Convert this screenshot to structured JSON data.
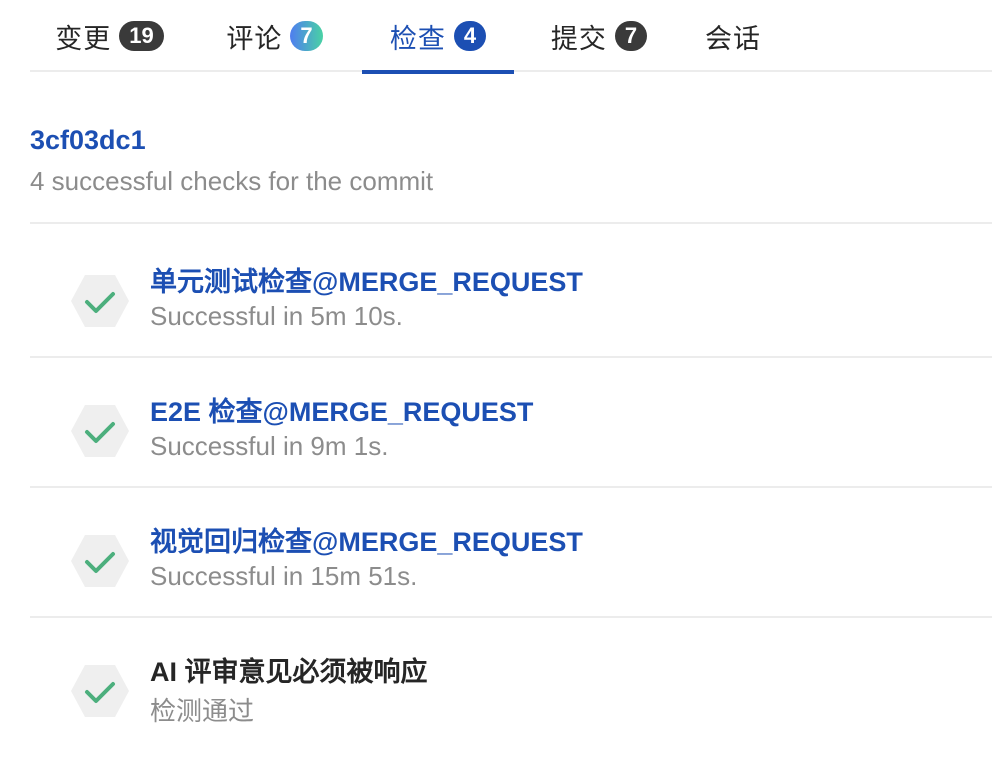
{
  "tabs": [
    {
      "label": "变更",
      "count": "19"
    },
    {
      "label": "评论",
      "count": "7"
    },
    {
      "label": "检查",
      "count": "4"
    },
    {
      "label": "提交",
      "count": "7"
    },
    {
      "label": "会话"
    }
  ],
  "active_tab": "检查",
  "colors": {
    "accent": "#1c4fb3",
    "success": "#4caf7d",
    "muted_text": "#8c8c8c",
    "badge_dark": "#3a3a3a"
  },
  "commit": {
    "hash": "3cf03dc1",
    "summary": "4 successful checks for the commit"
  },
  "checks": [
    {
      "title": "单元测试检查@MERGE_REQUEST",
      "status": "Successful in 5m 10s.",
      "icon": "check-icon",
      "link": true
    },
    {
      "title": "E2E 检查@MERGE_REQUEST",
      "status": "Successful in 9m 1s.",
      "icon": "check-icon",
      "link": true
    },
    {
      "title": "视觉回归检查@MERGE_REQUEST",
      "status": "Successful in 15m 51s.",
      "icon": "check-icon",
      "link": true
    },
    {
      "title": "AI 评审意见必须被响应",
      "status": "检测通过",
      "icon": "check-icon",
      "link": false
    }
  ]
}
